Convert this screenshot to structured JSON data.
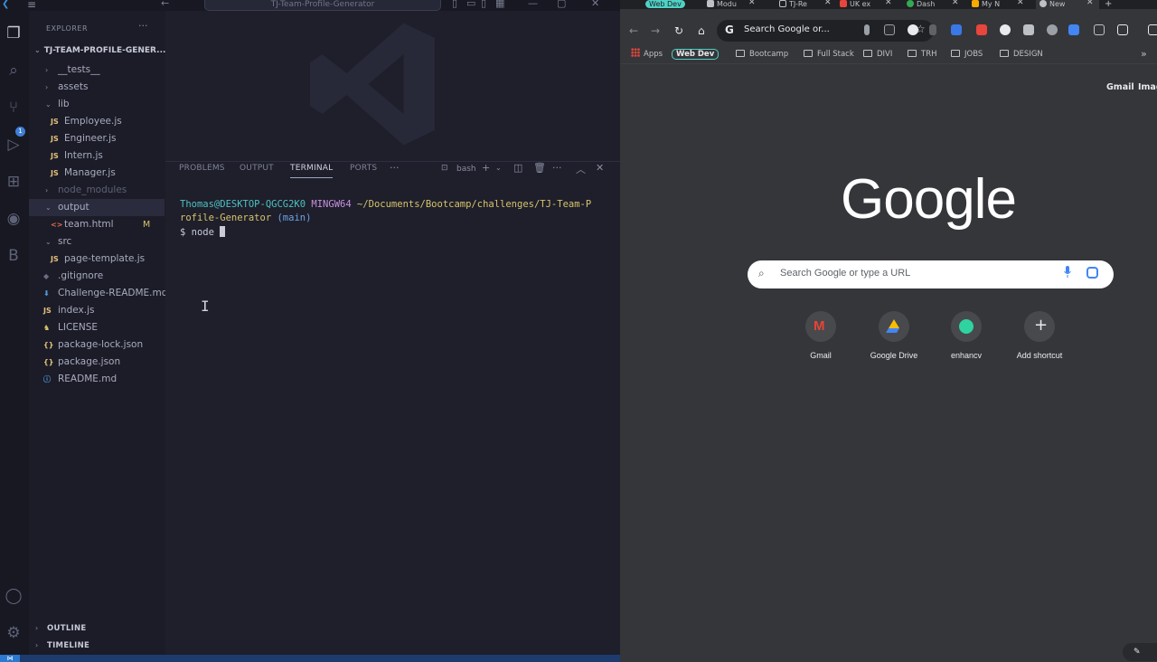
{
  "vscode": {
    "command_center": "TJ-Team-Profile-Generator",
    "explorer_title": "EXPLORER",
    "scm_badge": "1",
    "project_root": "TJ-TEAM-PROFILE-GENER...",
    "tree": [
      {
        "label": "__tests__",
        "kind": "folder",
        "open": false,
        "depth": 1
      },
      {
        "label": "assets",
        "kind": "folder",
        "open": false,
        "depth": 1
      },
      {
        "label": "lib",
        "kind": "folder",
        "open": true,
        "depth": 1
      },
      {
        "label": "Employee.js",
        "kind": "js",
        "depth": 2
      },
      {
        "label": "Engineer.js",
        "kind": "js",
        "depth": 2
      },
      {
        "label": "Intern.js",
        "kind": "js",
        "depth": 2
      },
      {
        "label": "Manager.js",
        "kind": "js",
        "depth": 2
      },
      {
        "label": "node_modules",
        "kind": "folder",
        "open": false,
        "depth": 1,
        "dim": true
      },
      {
        "label": "output",
        "kind": "folder",
        "open": true,
        "depth": 1,
        "selected": true
      },
      {
        "label": "team.html",
        "kind": "html",
        "depth": 2,
        "mark": "M"
      },
      {
        "label": "src",
        "kind": "folder",
        "open": true,
        "depth": 1
      },
      {
        "label": "page-template.js",
        "kind": "js",
        "depth": 2
      },
      {
        "label": ".gitignore",
        "kind": "git",
        "depth": 1
      },
      {
        "label": "Challenge-README.md",
        "kind": "md",
        "depth": 1
      },
      {
        "label": "index.js",
        "kind": "js",
        "depth": 1
      },
      {
        "label": "LICENSE",
        "kind": "license",
        "depth": 1
      },
      {
        "label": "package-lock.json",
        "kind": "json",
        "depth": 1
      },
      {
        "label": "package.json",
        "kind": "json",
        "depth": 1
      },
      {
        "label": "README.md",
        "kind": "info",
        "depth": 1
      }
    ],
    "outline_label": "OUTLINE",
    "timeline_label": "TIMELINE",
    "panel_tabs": [
      "PROBLEMS",
      "OUTPUT",
      "TERMINAL",
      "PORTS"
    ],
    "active_panel_tab": "TERMINAL",
    "terminal_shell": "bash",
    "terminal": {
      "user_host": "Thomas@DESKTOP-QGCG2K0",
      "env": "MINGW64",
      "path_line1": "~/Documents/Bootcamp/challenges/TJ-Team-P",
      "path_line2": "rofile-Generator",
      "branch": "(main)",
      "prompt": "$",
      "command": "node"
    }
  },
  "chrome": {
    "tabs": [
      {
        "label": "Web Dev",
        "kind": "group",
        "color": "#4fd1c5"
      },
      {
        "label": "Modu",
        "fav_color": "#bdc1c6"
      },
      {
        "label": "TJ-Re",
        "fav_color": "#202124"
      },
      {
        "label": "UK ex",
        "fav_color": "#e8453c"
      },
      {
        "label": "Dash",
        "fav_color": "#34a853"
      },
      {
        "label": "My N",
        "fav_color": "#f9ab00"
      },
      {
        "label": "New",
        "fav_color": "#bdc1c6",
        "active": true
      }
    ],
    "omnibox_text": "Search Google or...",
    "bookmarks": [
      {
        "label": "Apps",
        "kind": "apps"
      },
      {
        "label": "Web Dev",
        "kind": "group"
      },
      {
        "label": "Bootcamp",
        "kind": "folder"
      },
      {
        "label": "Full Stack",
        "kind": "folder"
      },
      {
        "label": "DIVI",
        "kind": "folder"
      },
      {
        "label": "TRH",
        "kind": "folder"
      },
      {
        "label": "JOBS",
        "kind": "folder"
      },
      {
        "label": "DESIGN",
        "kind": "folder"
      }
    ],
    "newtab": {
      "top_links": [
        "Gmail",
        "Images"
      ],
      "logo": "Google",
      "search_placeholder": "Search Google or type a URL",
      "shortcuts": [
        {
          "label": "Gmail",
          "icon": "gmail-icon"
        },
        {
          "label": "Google Drive",
          "icon": "drive-icon"
        },
        {
          "label": "enhancv",
          "icon": "enhancv-icon"
        },
        {
          "label": "Add shortcut",
          "icon": "plus-icon"
        }
      ]
    }
  },
  "colors": {
    "accent": "#4fd1c5",
    "vscode_bg": "#1e1f2b",
    "chrome_bg": "#35363a"
  }
}
